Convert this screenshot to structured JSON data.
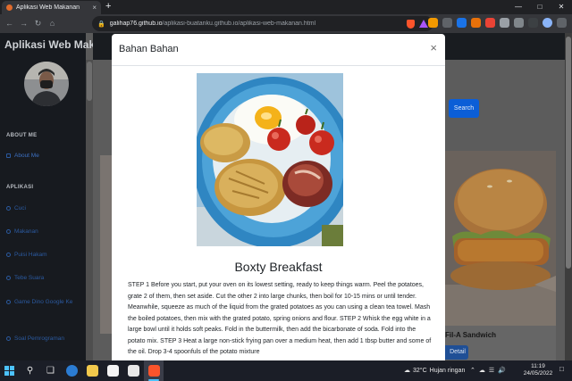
{
  "browser": {
    "tab_title": "Aplikasi Web Makanan",
    "tab_close": "×",
    "new_tab": "+",
    "url_host": "galihap76.github.io",
    "url_path": "/aplikasi-buatanku.github.io/aplikasi-web-makanan.html",
    "window_controls": [
      "—",
      "□",
      "✕"
    ]
  },
  "sidebar": {
    "brand": "Aplikasi Web Makanan",
    "section_about": "ABOUT ME",
    "about_item": "About Me",
    "section_app": "APLIKASI",
    "items": [
      "Cuci",
      "Makanan",
      "Puisi Hakam",
      "Tebe Suara",
      "Game Dino Google Ke",
      "Soal Pemrograman"
    ]
  },
  "main": {
    "search_label": "Search",
    "card_title": "Fil-A Sandwich",
    "card_button": "Detail"
  },
  "modal": {
    "title": "Bahan Bahan",
    "close": "×",
    "food_title": "Boxty Breakfast",
    "recipe": "STEP 1 Before you start, put your oven on its lowest setting, ready to keep things warm. Peel the potatoes, grate 2 of them, then set aside. Cut the other 2 into large chunks, then boil for 10-15 mins or until tender. Meanwhile, squeeze as much of the liquid from the grated potatoes as you can using a clean tea towel. Mash the boiled potatoes, then mix with the grated potato, spring onions and flour. STEP 2 Whisk the egg white in a large bowl until it holds soft peaks. Fold in the buttermilk, then add the bicarbonate of soda. Fold into the potato mix. STEP 3 Heat a large non-stick frying pan over a medium heat, then add 1 tbsp butter and some of the oil. Drop 3-4 spoonfuls of the potato mixture"
  },
  "taskbar": {
    "weather_temp": "32°C",
    "weather_text": "Hujan ringan",
    "time": "11:19",
    "date": "24/05/2022"
  }
}
